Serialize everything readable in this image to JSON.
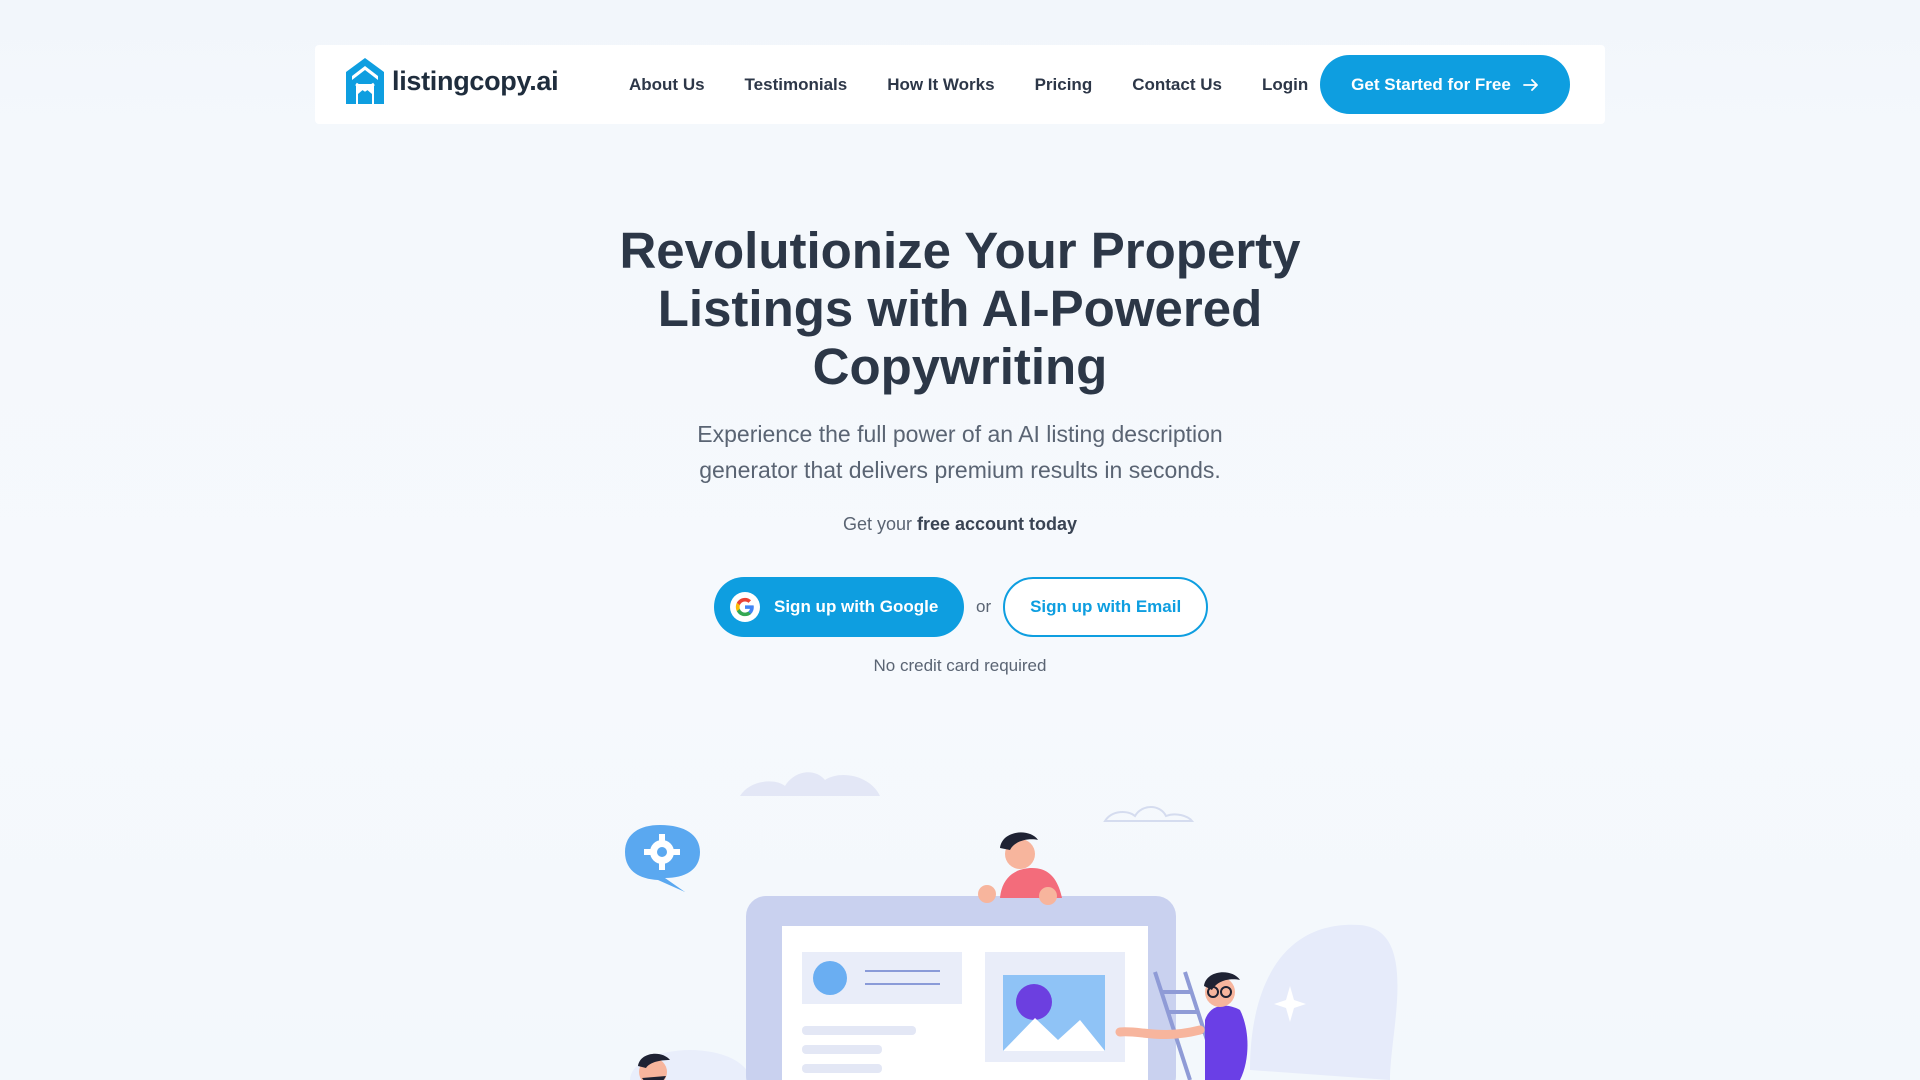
{
  "brand": {
    "name": "listingcopy.ai",
    "accent": "#0e9ee0",
    "text_dark": "#2c3747"
  },
  "nav": {
    "items": [
      {
        "label": "About Us"
      },
      {
        "label": "Testimonials"
      },
      {
        "label": "How It Works"
      },
      {
        "label": "Pricing"
      },
      {
        "label": "Contact Us"
      },
      {
        "label": "Login"
      }
    ],
    "cta_label": "Get Started for Free",
    "cta_icon": "arrow-right-icon"
  },
  "hero": {
    "headline_lines": [
      "Revolutionize Your Property",
      "Listings with AI-Powered",
      "Copywriting"
    ],
    "subhead_lines": [
      "Experience the full power of an AI listing description",
      "generator that delivers premium results in seconds."
    ],
    "free_prefix": "Get your",
    "free_bold": "free account today",
    "google_label": "Sign up with Google",
    "google_icon": "google-icon",
    "or_text": "or",
    "email_label": "Sign up with Email",
    "no_card": "No credit card required"
  },
  "illustration": {
    "icons": [
      "gear-icon",
      "image-icon",
      "cloud-icon",
      "sparkle-icon"
    ]
  }
}
